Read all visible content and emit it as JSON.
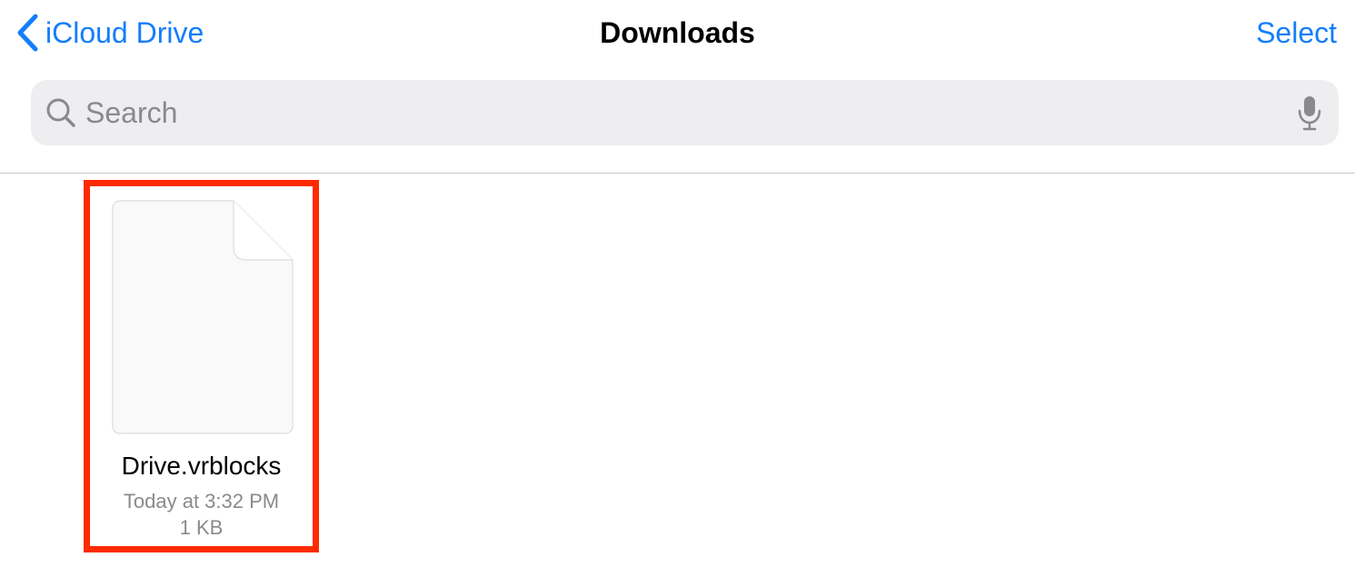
{
  "nav": {
    "back_label": "iCloud Drive",
    "title": "Downloads",
    "select_label": "Select"
  },
  "search": {
    "placeholder": "Search",
    "value": ""
  },
  "files": [
    {
      "name": "Drive.vrblocks",
      "date": "Today at 3:32 PM",
      "size": "1 KB",
      "icon": "document-icon",
      "highlighted": true
    }
  ],
  "colors": {
    "accent": "#147efb",
    "highlight": "#ff2a00",
    "secondary_text": "#8a8a8e",
    "search_bg": "#eeeef0"
  },
  "icons": {
    "back": "chevron-left-icon",
    "search": "search-icon",
    "mic": "microphone-icon"
  }
}
